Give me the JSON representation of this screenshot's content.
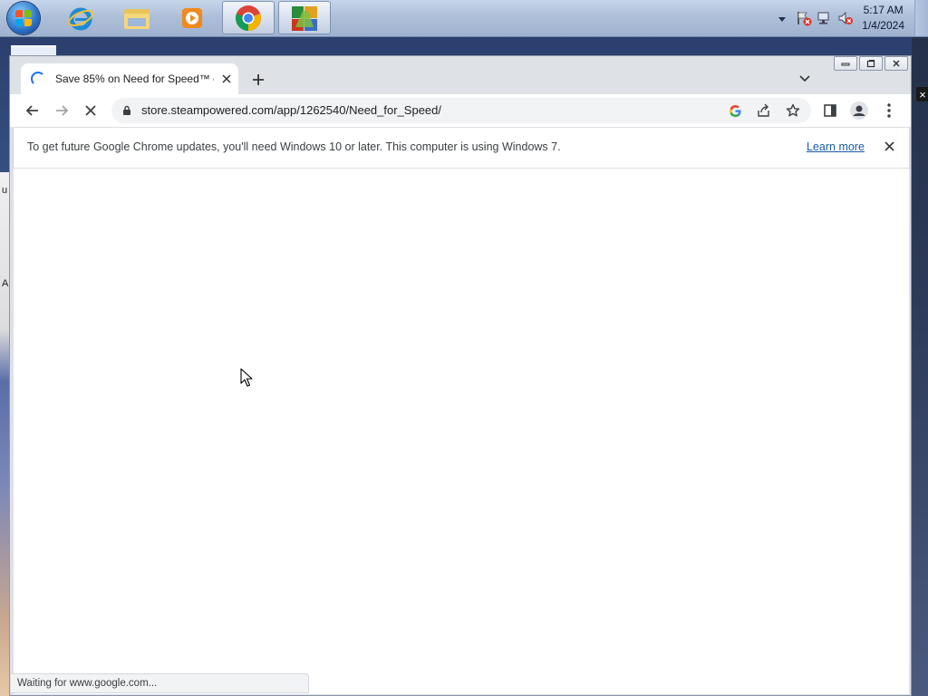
{
  "taskbar": {
    "apps": [
      {
        "name": "internet-explorer",
        "active": false
      },
      {
        "name": "windows-explorer",
        "active": false
      },
      {
        "name": "media-player",
        "active": false
      },
      {
        "name": "google-chrome",
        "active": true
      },
      {
        "name": "avg-antivirus",
        "active": true
      }
    ],
    "clock": {
      "time": "5:17 AM",
      "date": "1/4/2024"
    }
  },
  "desktop": {
    "left_char_1": "u",
    "left_char_2": "A"
  },
  "browser": {
    "tab": {
      "title": "Save 85% on Need for Speed™ o"
    },
    "address": {
      "url": "store.steampowered.com/app/1262540/Need_for_Speed/"
    },
    "infobar": {
      "message": "To get future Google Chrome updates, you'll need Windows 10 or later. This computer is using Windows 7.",
      "link": "Learn more"
    },
    "status": "Waiting for www.google.com..."
  },
  "colors": {
    "accent": "#1a73e8",
    "link": "#1a5aa8",
    "toolbar": "#dee1e6"
  }
}
